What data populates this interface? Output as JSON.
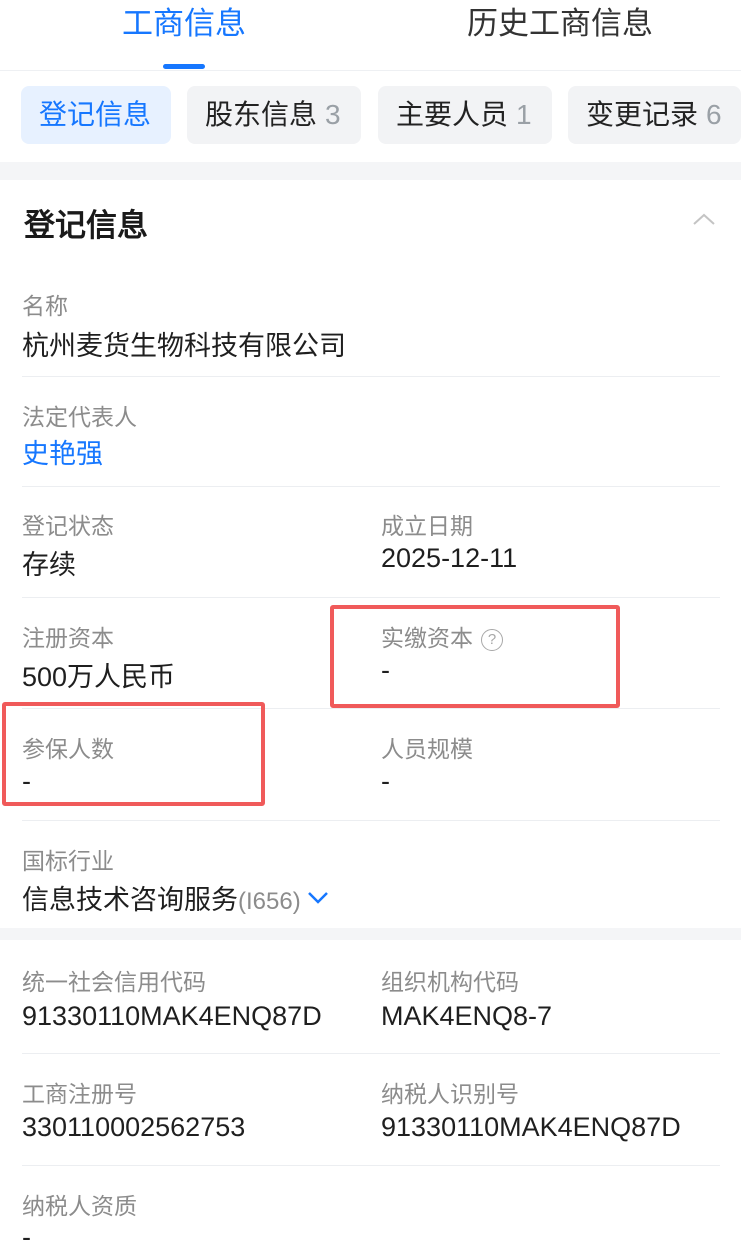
{
  "top_tabs": [
    {
      "label": "工商信息"
    },
    {
      "label": "历史工商信息"
    }
  ],
  "sub_tabs": [
    {
      "label": "登记信息",
      "count": ""
    },
    {
      "label": "股东信息",
      "count": "3"
    },
    {
      "label": "主要人员",
      "count": "1"
    },
    {
      "label": "变更记录",
      "count": "6"
    }
  ],
  "section": {
    "title": "登记信息"
  },
  "fields": {
    "name": {
      "label": "名称",
      "value": "杭州麦货生物科技有限公司"
    },
    "legal_rep": {
      "label": "法定代表人",
      "value": "史艳强"
    },
    "reg_status": {
      "label": "登记状态",
      "value": "存续"
    },
    "est_date": {
      "label": "成立日期",
      "value": "2025-12-11"
    },
    "reg_capital": {
      "label": "注册资本",
      "value": "500万人民币"
    },
    "paid_capital": {
      "label": "实缴资本",
      "value": "-",
      "help_icon": "?"
    },
    "insured_count": {
      "label": "参保人数",
      "value": "-"
    },
    "staff_scale": {
      "label": "人员规模",
      "value": "-"
    },
    "industry": {
      "label": "国标行业",
      "value": "信息技术咨询服务",
      "code": "(I656)"
    },
    "credit_code": {
      "label": "统一社会信用代码",
      "value": "91330110MAK4ENQ87D"
    },
    "org_code": {
      "label": "组织机构代码",
      "value": "MAK4ENQ8-7"
    },
    "biz_reg_no": {
      "label": "工商注册号",
      "value": "330110002562753"
    },
    "taxpayer_id": {
      "label": "纳税人识别号",
      "value": "91330110MAK4ENQ87D"
    },
    "taxpayer_qual": {
      "label": "纳税人资质",
      "value": "-"
    }
  },
  "icons": {
    "collapse": "chevron-up-icon",
    "help": "question-circle-icon",
    "expand": "chevron-down-icon"
  },
  "colors": {
    "accent": "#1677ff",
    "highlight": "#f05a5a",
    "label": "#8c8c8c"
  }
}
